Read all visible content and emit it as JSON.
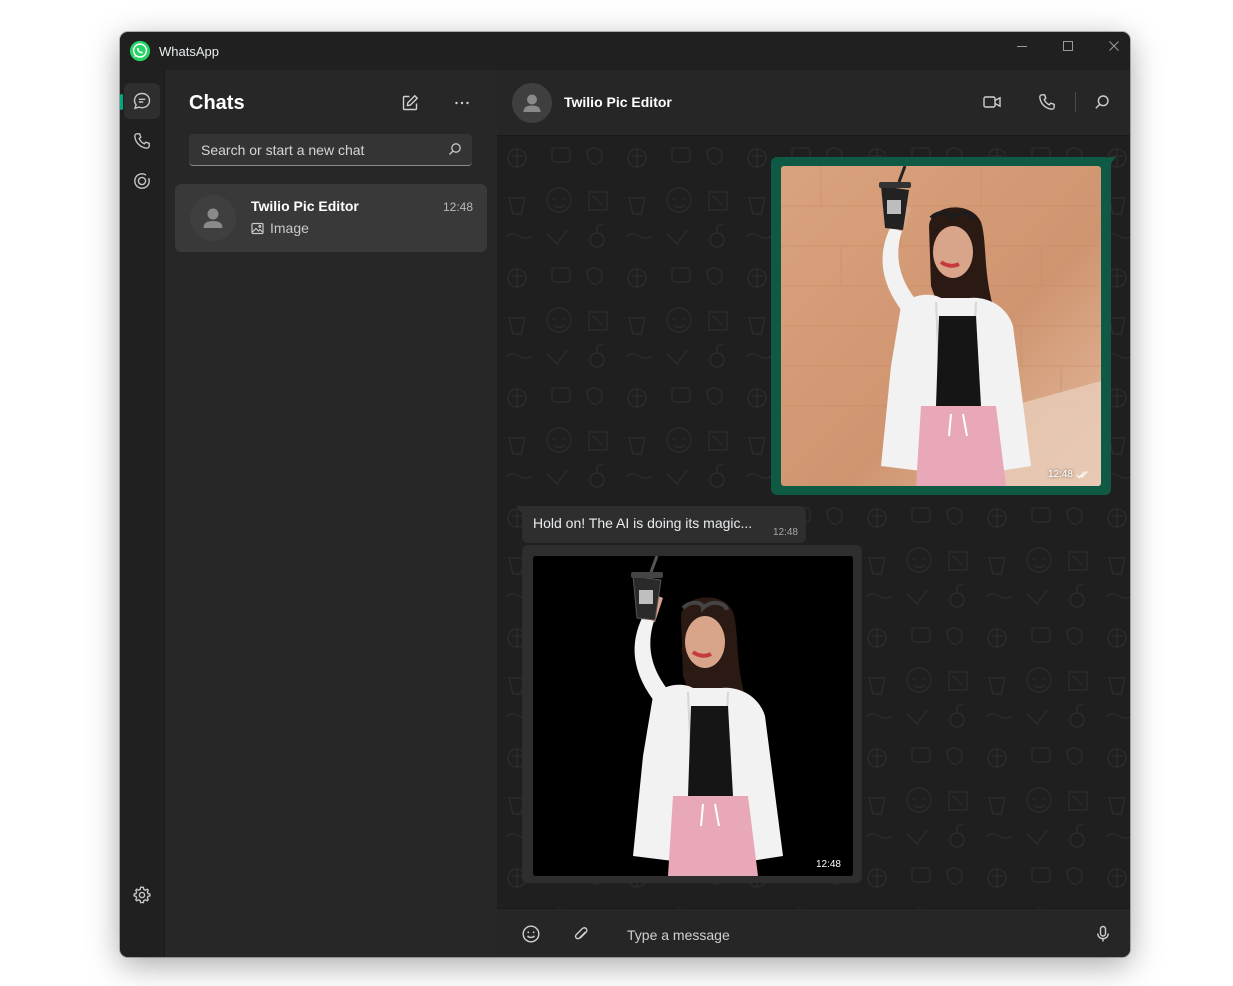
{
  "window": {
    "app_title": "WhatsApp",
    "controls": {
      "minimize": "minimize-icon",
      "maximize": "maximize-icon",
      "close": "close-icon"
    }
  },
  "rail": {
    "items": [
      {
        "id": "chats",
        "icon": "chat-icon",
        "active": true
      },
      {
        "id": "calls",
        "icon": "phone-icon",
        "active": false
      },
      {
        "id": "status",
        "icon": "status-icon",
        "active": false
      }
    ],
    "bottom": [
      {
        "id": "settings",
        "icon": "gear-icon"
      },
      {
        "id": "profile",
        "icon": "avatar"
      }
    ]
  },
  "chat_list": {
    "title": "Chats",
    "new_chat_icon": "compose-icon",
    "menu_icon": "more-icon",
    "search": {
      "placeholder": "Search or start a new chat",
      "value": ""
    },
    "items": [
      {
        "name": "Twilio Pic Editor",
        "time": "12:48",
        "preview": "Image",
        "preview_icon": "image-icon",
        "selected": true
      }
    ]
  },
  "conversation": {
    "contact_name": "Twilio Pic Editor",
    "header_icons": [
      "video-call-icon",
      "voice-call-icon",
      "search-icon"
    ],
    "messages": [
      {
        "direction": "out",
        "type": "image",
        "time": "12:48",
        "status": "read"
      },
      {
        "direction": "in",
        "type": "text",
        "text": "Hold on! The AI is doing its magic...",
        "time": "12:48"
      },
      {
        "direction": "in",
        "type": "image",
        "time": "12:48"
      }
    ],
    "composer": {
      "placeholder": "Type a message",
      "value": ""
    }
  },
  "colors": {
    "accent": "#00a884",
    "outgoing_bubble": "#0f5a45",
    "incoming_bubble": "#2e2e2e",
    "panel": "#272727",
    "window": "#202020"
  }
}
